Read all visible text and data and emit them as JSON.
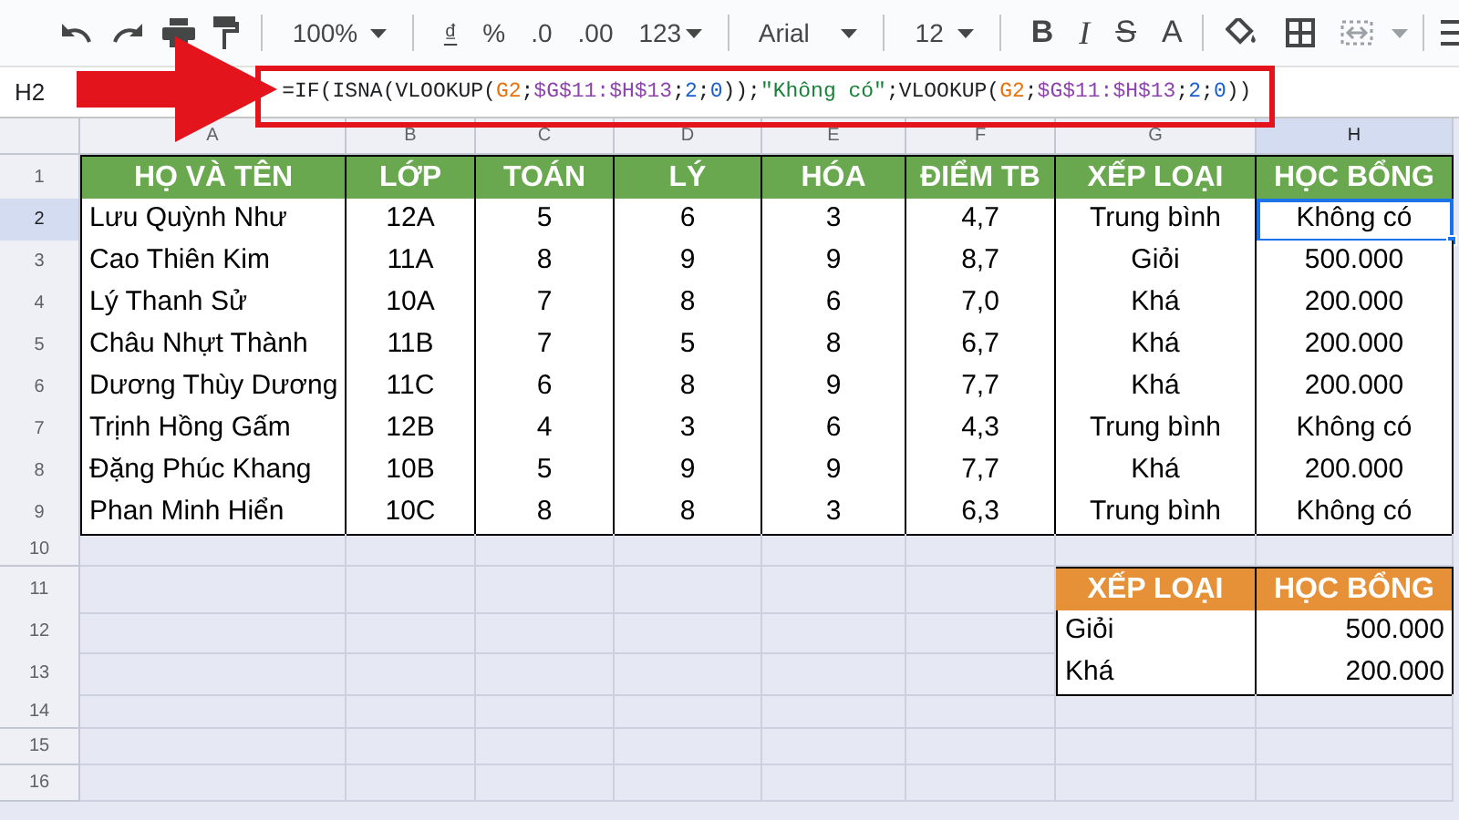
{
  "toolbar": {
    "zoom": "100%",
    "currency": "₫",
    "percent": "%",
    "decrease_decimals": ".0",
    "increase_decimals": ".00",
    "number_format": "123",
    "font": "Arial",
    "font_size": "12",
    "bold": "B",
    "italic": "I",
    "strikethrough": "S",
    "text_color": "A"
  },
  "formula_bar": {
    "cell": "H2",
    "formula": [
      {
        "text": "=IF(ISNA(VLOOKUP(",
        "color": "#202124"
      },
      {
        "text": "G2",
        "color": "#e8710a"
      },
      {
        "text": ";",
        "color": "#202124"
      },
      {
        "text": "$G$11:$H$13",
        "color": "#8e44ad"
      },
      {
        "text": ";",
        "color": "#202124"
      },
      {
        "text": "2",
        "color": "#1a5fd0"
      },
      {
        "text": ";",
        "color": "#202124"
      },
      {
        "text": "0",
        "color": "#1a5fd0"
      },
      {
        "text": "));",
        "color": "#202124"
      },
      {
        "text": "\"Không có\"",
        "color": "#188038"
      },
      {
        "text": ";VLOOKUP(",
        "color": "#202124"
      },
      {
        "text": "G2",
        "color": "#e8710a"
      },
      {
        "text": ";",
        "color": "#202124"
      },
      {
        "text": "$G$11:$H$13",
        "color": "#8e44ad"
      },
      {
        "text": ";",
        "color": "#202124"
      },
      {
        "text": "2",
        "color": "#1a5fd0"
      },
      {
        "text": ";",
        "color": "#202124"
      },
      {
        "text": "0",
        "color": "#1a5fd0"
      },
      {
        "text": "))",
        "color": "#202124"
      }
    ]
  },
  "column_headers": [
    "A",
    "B",
    "C",
    "D",
    "E",
    "F",
    "G",
    "H"
  ],
  "rows": [
    {
      "number": "1",
      "cells": [
        {
          "text": "HỌ VÀ TÊN",
          "kind": "header",
          "selected": false
        },
        {
          "text": "LỚP",
          "kind": "header",
          "selected": false
        },
        {
          "text": "TOÁN",
          "kind": "header",
          "selected": false
        },
        {
          "text": "LÝ",
          "kind": "header",
          "selected": false
        },
        {
          "text": "HÓA",
          "kind": "header",
          "selected": false
        },
        {
          "text": "ĐIỂM TB",
          "kind": "header",
          "selected": false
        },
        {
          "text": "XẾP LOẠI",
          "kind": "header",
          "selected": false
        },
        {
          "text": "HỌC BỔNG",
          "kind": "header",
          "selected": false
        }
      ]
    },
    {
      "number": "2",
      "cells": [
        {
          "text": "Lưu Quỳnh Như",
          "kind": "left",
          "selected": false
        },
        {
          "text": "12A",
          "kind": "center",
          "selected": false
        },
        {
          "text": "5",
          "kind": "center",
          "selected": false
        },
        {
          "text": "6",
          "kind": "center",
          "selected": false
        },
        {
          "text": "3",
          "kind": "center",
          "selected": false
        },
        {
          "text": "4,7",
          "kind": "center",
          "selected": false
        },
        {
          "text": "Trung bình",
          "kind": "center",
          "selected": false
        },
        {
          "text": "Không có",
          "kind": "center",
          "selected": true
        }
      ]
    },
    {
      "number": "3",
      "cells": [
        {
          "text": "Cao Thiên Kim",
          "kind": "left",
          "selected": false
        },
        {
          "text": "11A",
          "kind": "center",
          "selected": false
        },
        {
          "text": "8",
          "kind": "center",
          "selected": false
        },
        {
          "text": "9",
          "kind": "center",
          "selected": false
        },
        {
          "text": "9",
          "kind": "center",
          "selected": false
        },
        {
          "text": "8,7",
          "kind": "center",
          "selected": false
        },
        {
          "text": "Giỏi",
          "kind": "center",
          "selected": false
        },
        {
          "text": "500.000",
          "kind": "center",
          "selected": false
        }
      ]
    },
    {
      "number": "4",
      "cells": [
        {
          "text": "Lý Thanh Sử",
          "kind": "left",
          "selected": false
        },
        {
          "text": "10A",
          "kind": "center",
          "selected": false
        },
        {
          "text": "7",
          "kind": "center",
          "selected": false
        },
        {
          "text": "8",
          "kind": "center",
          "selected": false
        },
        {
          "text": "6",
          "kind": "center",
          "selected": false
        },
        {
          "text": "7,0",
          "kind": "center",
          "selected": false
        },
        {
          "text": "Khá",
          "kind": "center",
          "selected": false
        },
        {
          "text": "200.000",
          "kind": "center",
          "selected": false
        }
      ]
    },
    {
      "number": "5",
      "cells": [
        {
          "text": "Châu Nhựt Thành",
          "kind": "left",
          "selected": false
        },
        {
          "text": "11B",
          "kind": "center",
          "selected": false
        },
        {
          "text": "7",
          "kind": "center",
          "selected": false
        },
        {
          "text": "5",
          "kind": "center",
          "selected": false
        },
        {
          "text": "8",
          "kind": "center",
          "selected": false
        },
        {
          "text": "6,7",
          "kind": "center",
          "selected": false
        },
        {
          "text": "Khá",
          "kind": "center",
          "selected": false
        },
        {
          "text": "200.000",
          "kind": "center",
          "selected": false
        }
      ]
    },
    {
      "number": "6",
      "cells": [
        {
          "text": "Dương Thùy Dương",
          "kind": "left",
          "selected": false
        },
        {
          "text": "11C",
          "kind": "center",
          "selected": false
        },
        {
          "text": "6",
          "kind": "center",
          "selected": false
        },
        {
          "text": "8",
          "kind": "center",
          "selected": false
        },
        {
          "text": "9",
          "kind": "center",
          "selected": false
        },
        {
          "text": "7,7",
          "kind": "center",
          "selected": false
        },
        {
          "text": "Khá",
          "kind": "center",
          "selected": false
        },
        {
          "text": "200.000",
          "kind": "center",
          "selected": false
        }
      ]
    },
    {
      "number": "7",
      "cells": [
        {
          "text": "Trịnh Hồng Gấm",
          "kind": "left",
          "selected": false
        },
        {
          "text": "12B",
          "kind": "center",
          "selected": false
        },
        {
          "text": "4",
          "kind": "center",
          "selected": false
        },
        {
          "text": "3",
          "kind": "center",
          "selected": false
        },
        {
          "text": "6",
          "kind": "center",
          "selected": false
        },
        {
          "text": "4,3",
          "kind": "center",
          "selected": false
        },
        {
          "text": "Trung bình",
          "kind": "center",
          "selected": false
        },
        {
          "text": "Không có",
          "kind": "center",
          "selected": false
        }
      ]
    },
    {
      "number": "8",
      "cells": [
        {
          "text": "Đặng Phúc Khang",
          "kind": "left",
          "selected": false
        },
        {
          "text": "10B",
          "kind": "center",
          "selected": false
        },
        {
          "text": "5",
          "kind": "center",
          "selected": false
        },
        {
          "text": "9",
          "kind": "center",
          "selected": false
        },
        {
          "text": "9",
          "kind": "center",
          "selected": false
        },
        {
          "text": "7,7",
          "kind": "center",
          "selected": false
        },
        {
          "text": "Khá",
          "kind": "center",
          "selected": false
        },
        {
          "text": "200.000",
          "kind": "center",
          "selected": false
        }
      ]
    },
    {
      "number": "9",
      "cells": [
        {
          "text": "Phan Minh Hiển",
          "kind": "left",
          "selected": false
        },
        {
          "text": "10C",
          "kind": "center",
          "selected": false
        },
        {
          "text": "8",
          "kind": "center",
          "selected": false
        },
        {
          "text": "8",
          "kind": "center",
          "selected": false
        },
        {
          "text": "3",
          "kind": "center",
          "selected": false
        },
        {
          "text": "6,3",
          "kind": "center",
          "selected": false
        },
        {
          "text": "Trung bình",
          "kind": "center",
          "selected": false
        },
        {
          "text": "Không có",
          "kind": "center",
          "selected": false
        }
      ]
    },
    {
      "number": "10"
    },
    {
      "number": "11",
      "cells": [
        {
          "kind": "empty",
          "selected": false
        },
        {
          "kind": "empty",
          "selected": false
        },
        {
          "kind": "empty",
          "selected": false
        },
        {
          "kind": "empty",
          "selected": false
        },
        {
          "kind": "empty",
          "selected": false
        },
        {
          "kind": "empty",
          "selected": false
        },
        {
          "text": "XẾP LOẠI",
          "kind": "lookup_header",
          "selected": false
        },
        {
          "text": "HỌC BỔNG",
          "kind": "lookup_header",
          "selected": false
        }
      ]
    },
    {
      "number": "12",
      "cells": [
        {
          "kind": "empty",
          "selected": false
        },
        {
          "kind": "empty",
          "selected": false
        },
        {
          "kind": "empty",
          "selected": false
        },
        {
          "kind": "empty",
          "selected": false
        },
        {
          "kind": "empty",
          "selected": false
        },
        {
          "kind": "empty",
          "selected": false
        },
        {
          "text": "Giỏi",
          "kind": "lookup_left",
          "selected": false
        },
        {
          "text": "500.000",
          "kind": "lookup_right",
          "selected": false
        }
      ]
    },
    {
      "number": "13",
      "cells": [
        {
          "kind": "empty",
          "selected": false
        },
        {
          "kind": "empty",
          "selected": false
        },
        {
          "kind": "empty",
          "selected": false
        },
        {
          "kind": "empty",
          "selected": false
        },
        {
          "kind": "empty",
          "selected": false
        },
        {
          "kind": "empty",
          "selected": false
        },
        {
          "text": "Khá",
          "kind": "lookup_left",
          "selected": false
        },
        {
          "text": "200.000",
          "kind": "lookup_right",
          "selected": false
        }
      ]
    },
    {
      "number": "14"
    },
    {
      "number": "15"
    },
    {
      "number": "16"
    }
  ]
}
